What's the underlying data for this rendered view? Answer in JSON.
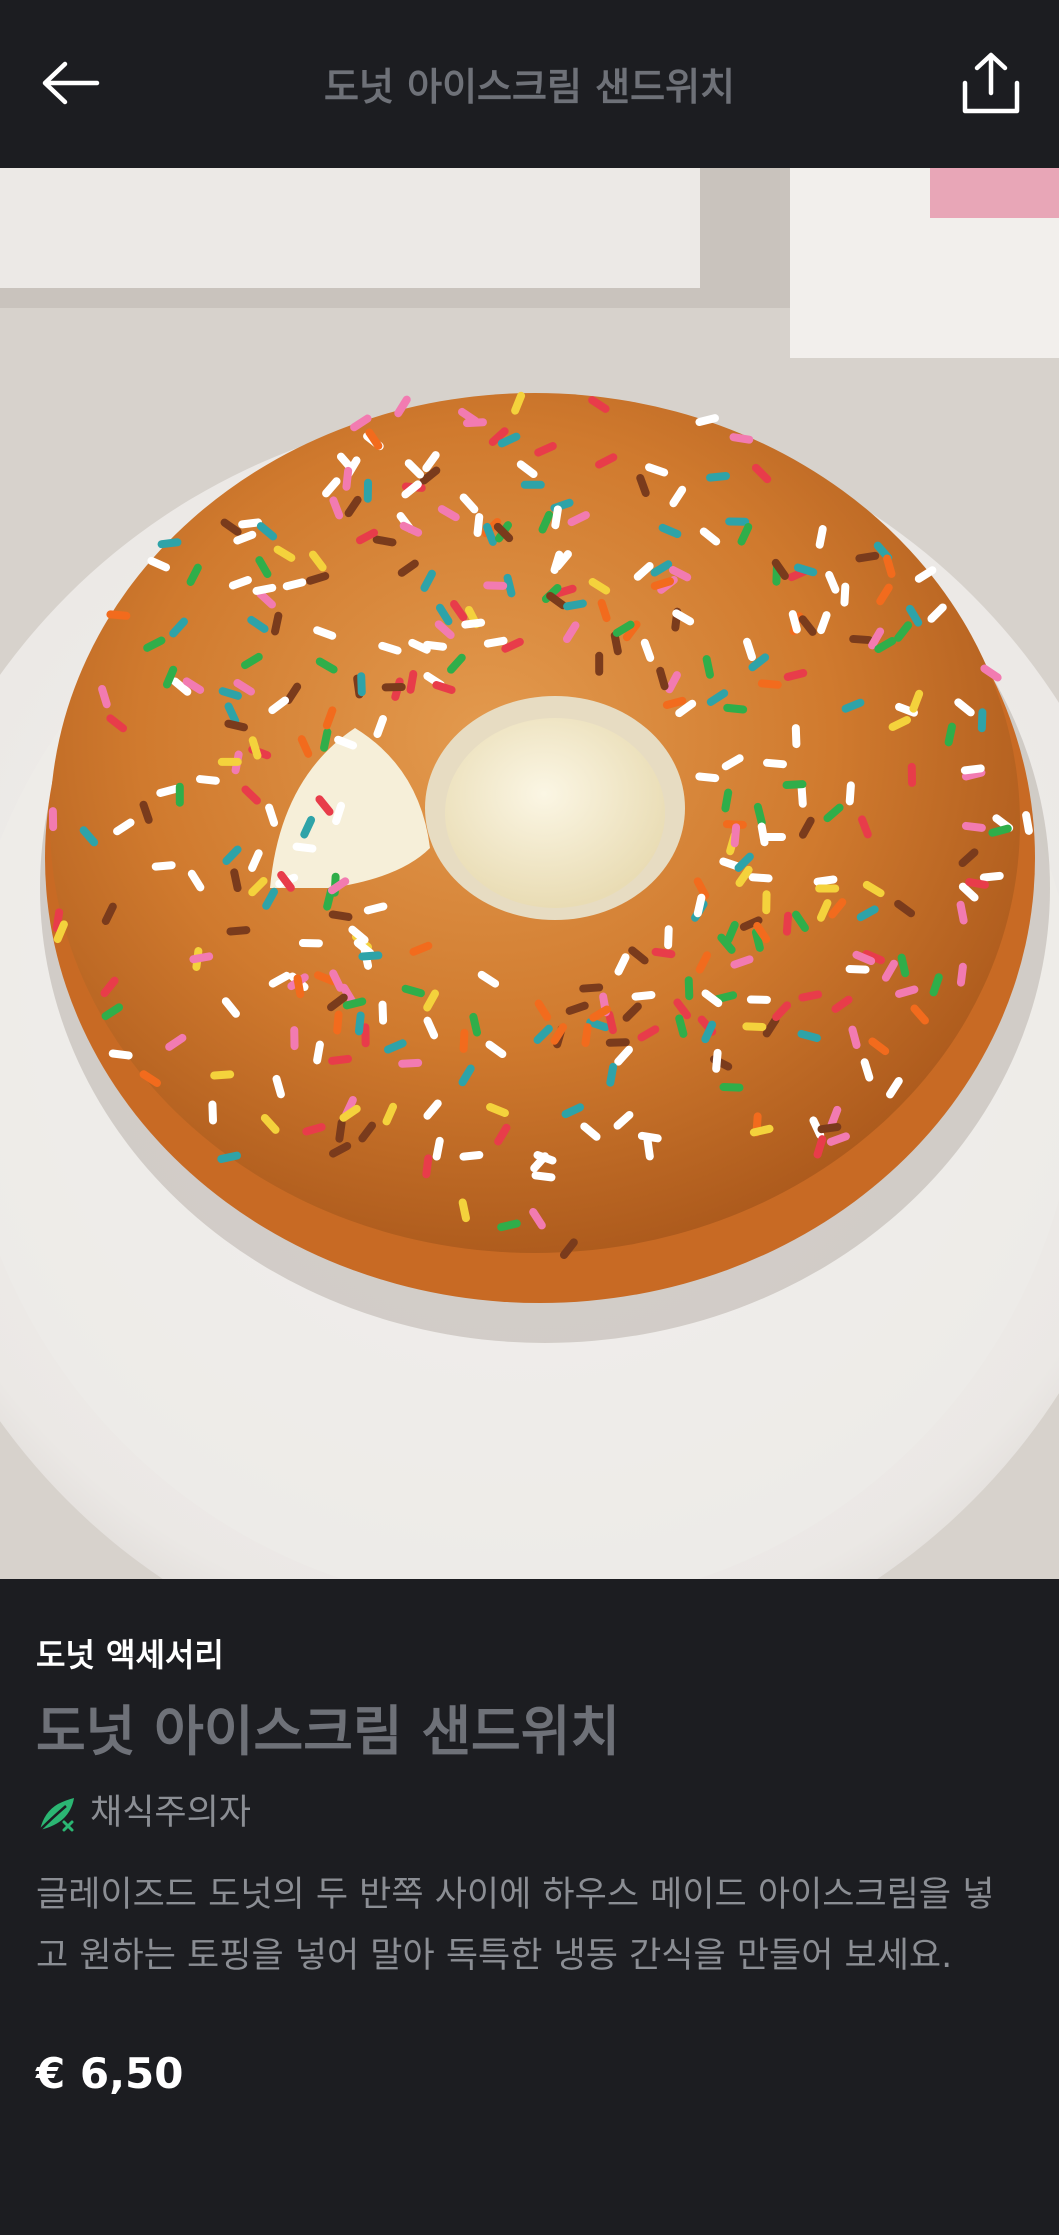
{
  "header": {
    "title": "도넛 아이스크림 샌드위치",
    "back_icon": "arrow-left-icon",
    "share_icon": "share-icon"
  },
  "hero": {
    "subject": "product-photo",
    "colors": {
      "donut": "#d07a2e",
      "plate": "#f1efed",
      "cream": "#f4ecd1"
    }
  },
  "product": {
    "category": "도넛 액세서리",
    "title": "도넛 아이스크림 샌드위치",
    "diet_tag": "채식주의자",
    "diet_icon": "vegan-leaf-icon",
    "description": "글레이즈드 도넛의 두 반쪽 사이에 하우스 메이드 아이스크림을 넣고 원하는 토핑을 넣어 말아 독특한 냉동 간식을 만들어 보세요.",
    "price": "€ 6,50"
  },
  "colors": {
    "background": "#1c1d21",
    "title_muted": "#6e7178",
    "body_text": "#8b8e94",
    "tag_green": "#2bb673"
  }
}
